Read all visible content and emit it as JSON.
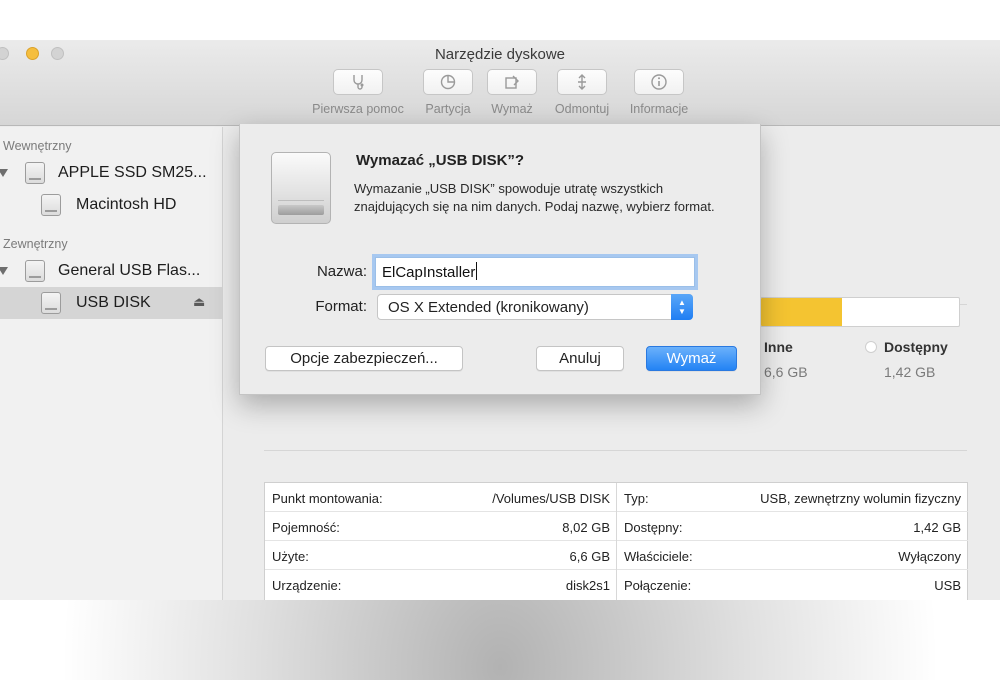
{
  "window": {
    "title": "Narzędzie dyskowe"
  },
  "toolbar": {
    "items": [
      {
        "label": "Pierwsza pomoc",
        "icon": "stethoscope-icon"
      },
      {
        "label": "Partycja",
        "icon": "pie-icon"
      },
      {
        "label": "Wymaż",
        "icon": "erase-icon"
      },
      {
        "label": "Odmontuj",
        "icon": "unmount-icon"
      },
      {
        "label": "Informacje",
        "icon": "info-icon"
      }
    ]
  },
  "sidebar": {
    "internal_label": "Wewnętrzny",
    "external_label": "Zewnętrzny",
    "items": [
      {
        "label": "APPLE SSD SM25..."
      },
      {
        "label": "Macintosh HD"
      },
      {
        "label": "General USB Flas..."
      },
      {
        "label": "USB DISK"
      }
    ]
  },
  "usage": {
    "fill_fraction": 0.41,
    "fill_color": "#f4c431",
    "other_label": "Inne",
    "other_value": "6,6 GB",
    "free_label": "Dostępny",
    "free_value": "1,42 GB"
  },
  "info_table": {
    "left": [
      {
        "key": "Punkt montowania:",
        "value": "/Volumes/USB DISK"
      },
      {
        "key": "Pojemność:",
        "value": "8,02 GB"
      },
      {
        "key": "Użyte:",
        "value": "6,6 GB"
      },
      {
        "key": "Urządzenie:",
        "value": "disk2s1"
      }
    ],
    "right": [
      {
        "key": "Typ:",
        "value": "USB, zewnętrzny wolumin fizyczny"
      },
      {
        "key": "Dostępny:",
        "value": "1,42 GB"
      },
      {
        "key": "Właściciele:",
        "value": "Wyłączony"
      },
      {
        "key": "Połączenie:",
        "value": "USB"
      }
    ]
  },
  "dialog": {
    "title": "Wymazać „USB DISK”?",
    "message": "Wymazanie „USB DISK” spowoduje utratę wszystkich znajdujących się na nim danych. Podaj nazwę, wybierz format.",
    "name_label": "Nazwa:",
    "name_value": "ElCapInstaller",
    "format_label": "Format:",
    "format_value": "OS X Extended (kronikowany)",
    "security_button": "Opcje zabezpieczeń...",
    "cancel_button": "Anuluj",
    "erase_button": "Wymaż",
    "accent_color": "#2383f4"
  }
}
